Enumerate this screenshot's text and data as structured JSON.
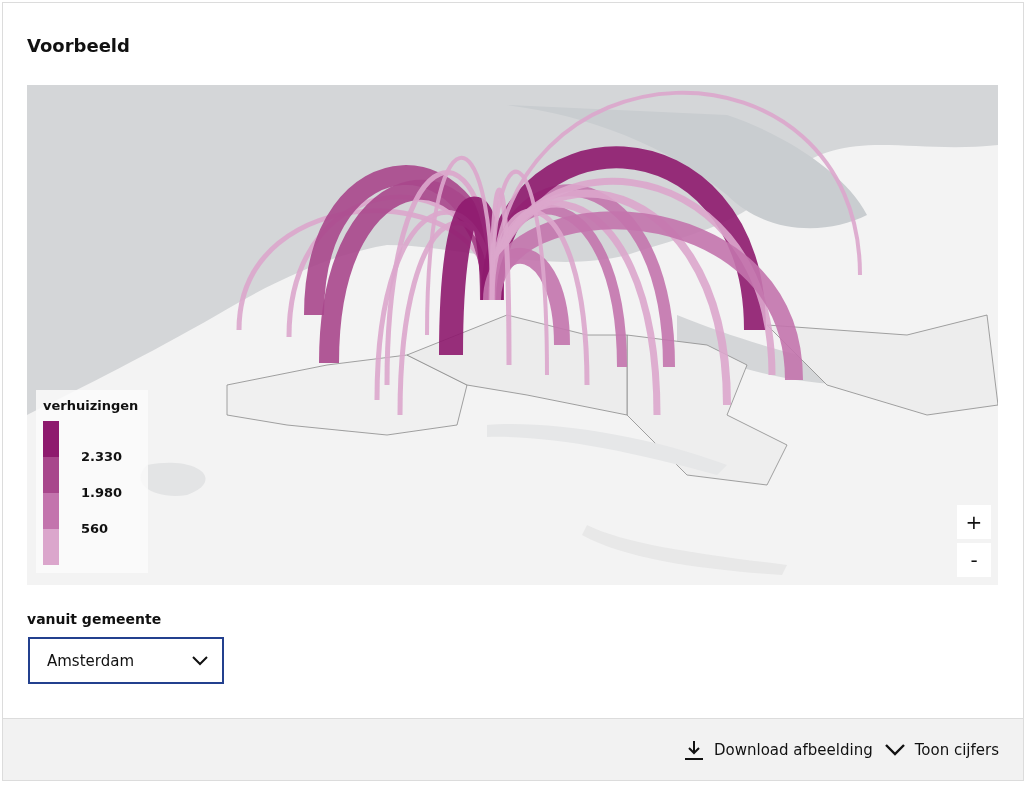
{
  "title": "Voorbeeld",
  "map": {
    "kind": "picture",
    "legend": {
      "title": "verhuizingen",
      "bins": [
        {
          "color": "#8e1a6e"
        },
        {
          "color": "#a8478c"
        },
        {
          "color": "#c374ad"
        },
        {
          "color": "#dba6cc"
        }
      ],
      "labels": [
        "2.330",
        "1.980",
        "560"
      ]
    },
    "zoom_buttons": [
      "+",
      "-"
    ]
  },
  "filter": {
    "label": "vanuit gemeente",
    "value": "Amsterdam"
  },
  "footer": {
    "actions": [
      {
        "kind": "download",
        "label": "Download afbeelding"
      },
      {
        "kind": "toggle",
        "label": "Toon cijfers"
      }
    ]
  }
}
